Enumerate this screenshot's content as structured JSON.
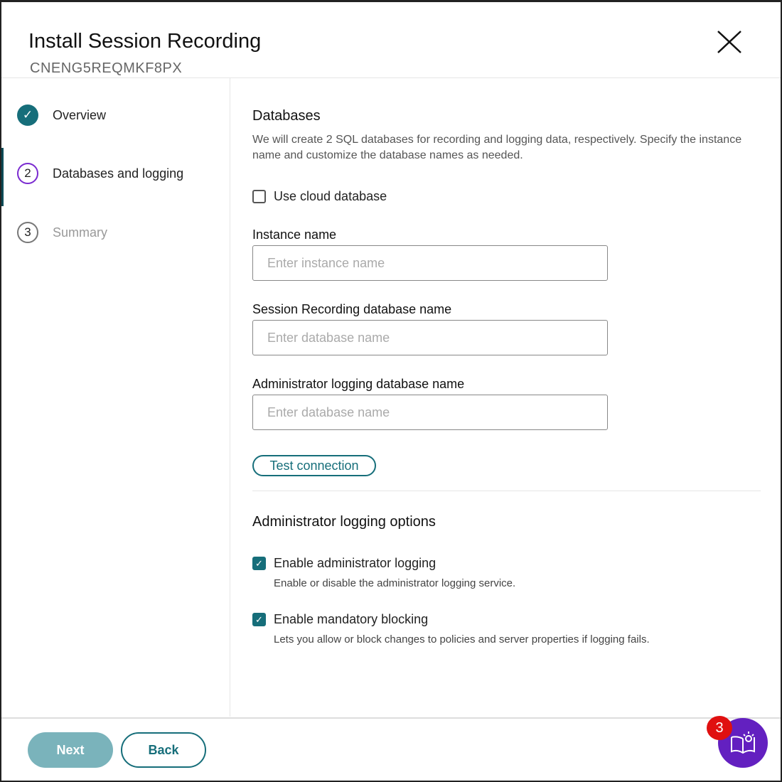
{
  "header": {
    "title": "Install Session Recording",
    "subtitle": "CNENG5REQMKF8PX"
  },
  "steps": [
    {
      "label": "Overview",
      "marker": "check"
    },
    {
      "label": "Databases and logging",
      "marker": "2"
    },
    {
      "label": "Summary",
      "marker": "3"
    }
  ],
  "databases": {
    "heading": "Databases",
    "description": "We will create 2 SQL databases for recording and logging data, respectively. Specify the instance name and customize the database names as needed.",
    "cloud_label": "Use cloud database",
    "cloud_checked": false,
    "instance_label": "Instance name",
    "instance_placeholder": "Enter instance name",
    "sr_label": "Session Recording database name",
    "sr_placeholder": "Enter database name",
    "admin_label": "Administrator logging database name",
    "admin_placeholder": "Enter database name",
    "test_label": "Test connection"
  },
  "logging": {
    "heading": "Administrator logging options",
    "enable_label": "Enable administrator logging",
    "enable_help": "Enable or disable the administrator logging service.",
    "enable_checked": true,
    "blocking_label": "Enable mandatory blocking",
    "blocking_help": "Lets you allow or block changes to policies and server properties if logging fails.",
    "blocking_checked": true
  },
  "footer": {
    "next": "Next",
    "back": "Back",
    "badge": "3"
  },
  "colors": {
    "accent": "#166e7a",
    "purple": "#6320c0"
  }
}
